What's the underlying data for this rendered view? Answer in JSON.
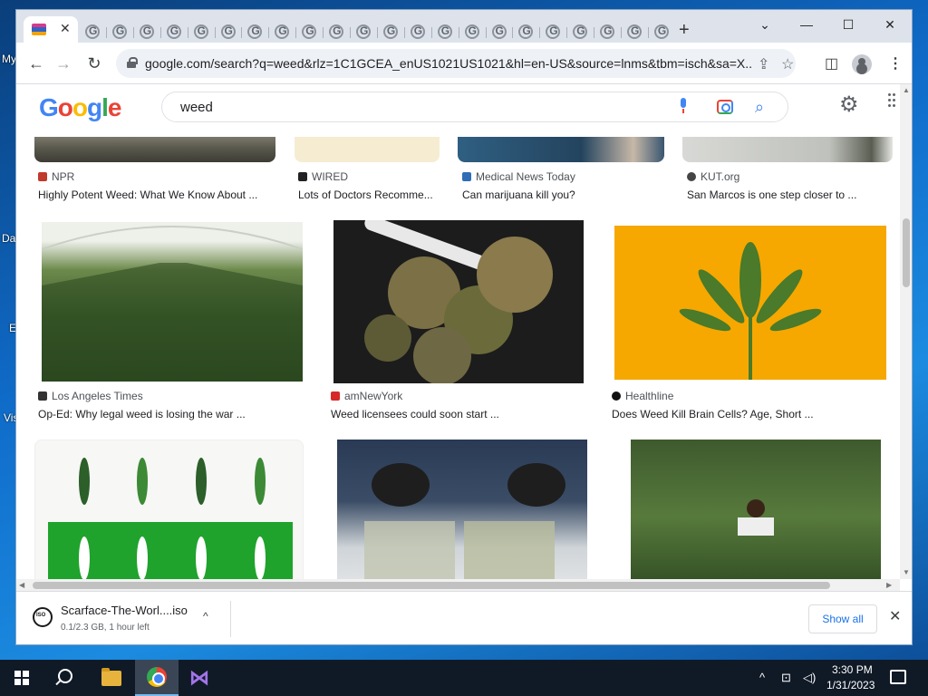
{
  "desktop": {
    "labels": [
      "My",
      "Da",
      "E",
      "Vis"
    ]
  },
  "browser": {
    "tab_active_close": "✕",
    "new_tab": "+",
    "window_controls": {
      "dropdown": "⌄",
      "minimize": "—",
      "maximize": "☐",
      "close": "✕"
    },
    "toolbar": {
      "back": "←",
      "forward": "→",
      "reload": "↻"
    },
    "url": "google.com/search?q=weed&rlz=1C1GCEA_enUS1021US1021&hl=en-US&source=lnms&tbm=isch&sa=X..."
  },
  "google": {
    "logo_letters": [
      "G",
      "o",
      "o",
      "g",
      "l",
      "e"
    ],
    "search_query": "weed",
    "search_icon": "🔍",
    "settings_icon": "⚙"
  },
  "results": {
    "row1": [
      {
        "source": "NPR",
        "title": "Highly Potent Weed: What We Know About ...",
        "icon_color": "#c0392b"
      },
      {
        "source": "WIRED",
        "title": "Lots of Doctors Recomme...",
        "icon_color": "#222222"
      },
      {
        "source": "Medical News Today",
        "title": "Can marijuana kill you?",
        "icon_color": "#2f6db5"
      },
      {
        "source": "KUT.org",
        "title": "San Marcos is one step closer to ...",
        "icon_color": "#444444"
      }
    ],
    "row2": [
      {
        "source": "Los Angeles Times",
        "title": "Op-Ed: Why legal weed is losing the war ...",
        "icon_color": "#333333"
      },
      {
        "source": "amNewYork",
        "title": "Weed licensees could soon start ...",
        "icon_color": "#d62828"
      },
      {
        "source": "Healthline",
        "title": "Does Weed Kill Brain Cells? Age, Short ...",
        "icon_color": "#111111"
      }
    ]
  },
  "download": {
    "filename": "Scarface-The-Worl....iso",
    "status": "0.1/2.3 GB, 1 hour left",
    "show_all": "Show all",
    "close": "✕",
    "chevron": "^"
  },
  "taskbar": {
    "time": "3:30 PM",
    "date": "1/31/2023",
    "vs_glyph": "⋈"
  },
  "colors": {
    "google_blue": "#4285f4",
    "google_red": "#ea4335",
    "google_yellow": "#fbbc05",
    "google_green": "#34a853",
    "link_blue": "#1a73e8"
  }
}
